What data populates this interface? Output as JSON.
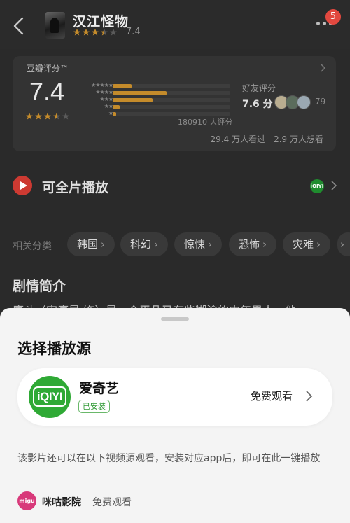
{
  "header": {
    "title": "汉江怪物",
    "score": "7.4",
    "stars": [
      1,
      1,
      1,
      0.5,
      0
    ],
    "badge_count": "5",
    "star_color": "#c48b2b"
  },
  "rating_card": {
    "title": "豆瓣评分™",
    "score": "7.4",
    "stars": [
      1,
      1,
      1,
      0.5,
      0
    ],
    "distribution": [
      {
        "label": "★★★★★",
        "fraction": 0.16
      },
      {
        "label": "★★★★",
        "fraction": 0.46
      },
      {
        "label": "★★★",
        "fraction": 0.34
      },
      {
        "label": "★★",
        "fraction": 0.06
      },
      {
        "label": "★",
        "fraction": 0.03
      }
    ],
    "count_text": "180910 人评分",
    "friends_label": "好友评分",
    "friends_score": "7.6 分",
    "friends_count": "79",
    "watched": "29.4 万人看过",
    "wanted": "2.9 万人想看"
  },
  "playback": {
    "label": "可全片播放",
    "source_icon": "iqiyi-icon"
  },
  "categories": {
    "label": "相关分类",
    "items": [
      "韩国",
      "科幻",
      "惊悚",
      "恐怖",
      "灾难"
    ]
  },
  "synopsis": {
    "title": "剧情简介",
    "text": "康斗（宋康昊 饰）是一个平凡又有些糊涂的中年男人，他"
  },
  "sheet": {
    "title": "选择播放源",
    "source": {
      "logo_text": "iQIYI",
      "name": "爱奇艺",
      "status": "已安装",
      "action": "免费观看"
    },
    "note": "该影片还可以在以下视频源观看，安装对应app后，即可在此一键播放",
    "alt_source": {
      "logo_text": "migu",
      "name": "咪咕影院",
      "action": "免费观看"
    }
  }
}
